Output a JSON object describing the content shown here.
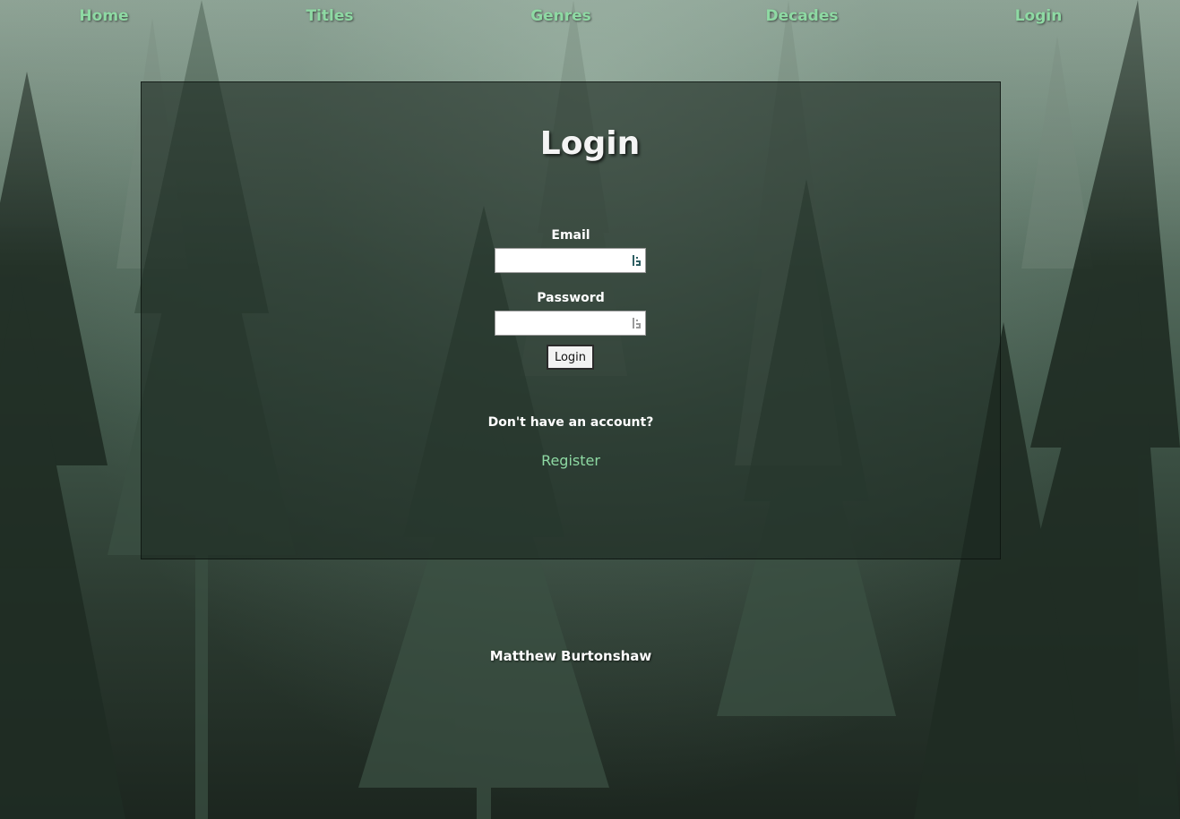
{
  "nav": {
    "items": [
      {
        "label": "Home"
      },
      {
        "label": "Titles"
      },
      {
        "label": "Genres"
      },
      {
        "label": "Decades"
      },
      {
        "label": "Login"
      }
    ]
  },
  "login": {
    "title": "Login",
    "email_label": "Email",
    "email_value": "",
    "password_label": "Password",
    "password_value": "",
    "submit_label": "Login",
    "no_account_text": "Don't have an account?",
    "register_label": "Register"
  },
  "footer": {
    "author": "Matthew Burtonshaw"
  },
  "colors": {
    "link": "#8ed9a3",
    "panel": "#1c2820",
    "text": "#ffffff"
  },
  "icons": {
    "field_autofill": "password-manager-icon",
    "background": "misty-pine-forest"
  }
}
